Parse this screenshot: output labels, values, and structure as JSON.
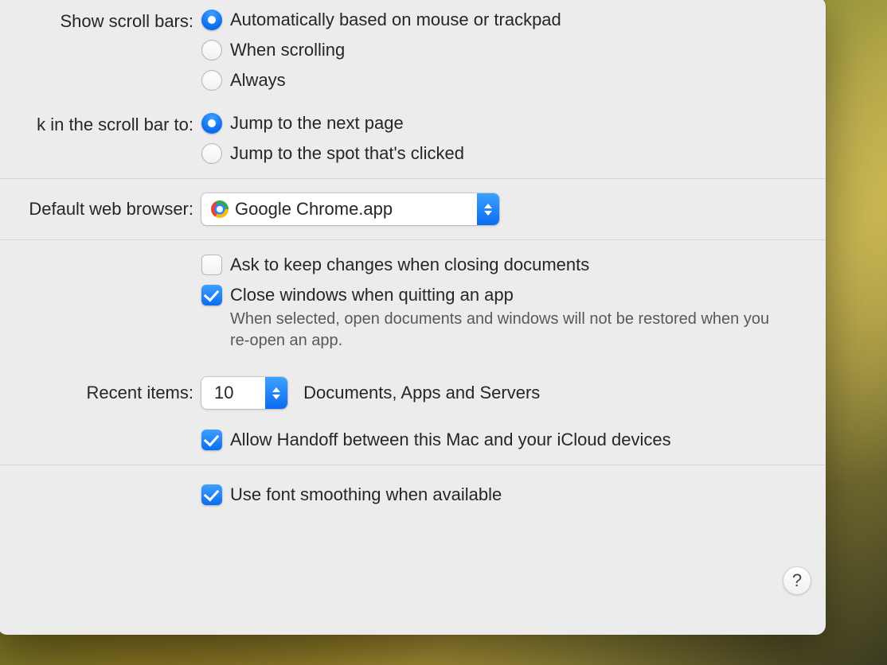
{
  "scrollbars": {
    "label": "Show scroll bars:",
    "options": {
      "auto": "Automatically based on mouse or trackpad",
      "scroll": "When scrolling",
      "always": "Always"
    }
  },
  "clickScroll": {
    "label": "k in the scroll bar to:",
    "options": {
      "nextPage": "Jump to the next page",
      "spot": "Jump to the spot that's clicked"
    }
  },
  "browser": {
    "label": "Default web browser:",
    "value": "Google Chrome.app"
  },
  "documents": {
    "ask": "Ask to keep changes when closing documents",
    "close": "Close windows when quitting an app",
    "closeDesc": "When selected, open documents and windows will not be restored when you re-open an app."
  },
  "recent": {
    "label": "Recent items:",
    "value": "10",
    "rest": "Documents, Apps and Servers"
  },
  "handoff": "Allow Handoff between this Mac and your iCloud devices",
  "fontSmoothing": "Use font smoothing when available",
  "helpGlyph": "?"
}
